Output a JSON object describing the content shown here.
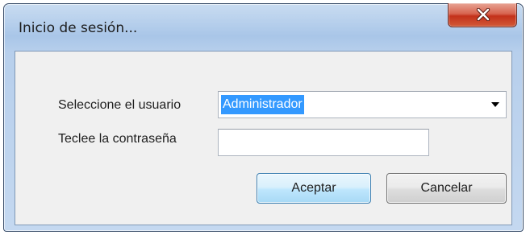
{
  "window": {
    "title": "Inicio de sesión..."
  },
  "form": {
    "user_label": "Seleccione el usuario",
    "user_selected": "Administrador",
    "password_label": "Teclee la contraseña",
    "password_value": ""
  },
  "buttons": {
    "accept_label": "Aceptar",
    "cancel_label": "Cancelar"
  },
  "icons": {
    "close": "close-icon",
    "dropdown": "chevron-down-icon"
  },
  "colors": {
    "selection": "#3399ff",
    "close_button": "#c3311b",
    "default_button_border": "#3c7fb1"
  }
}
